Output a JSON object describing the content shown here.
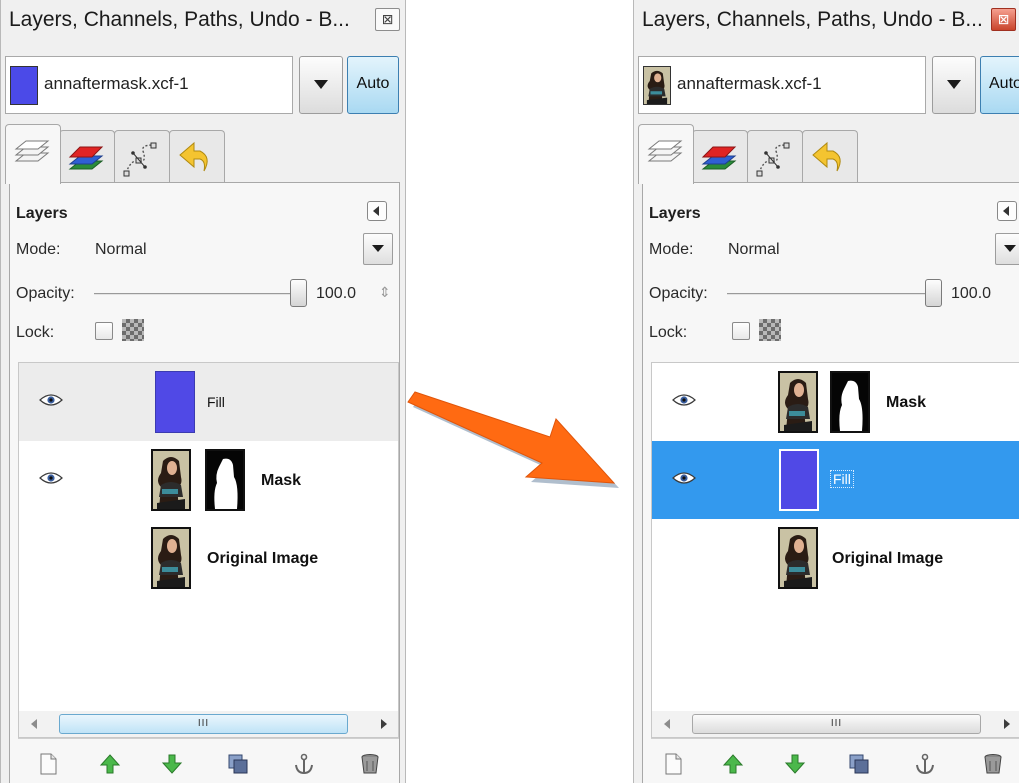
{
  "window": {
    "title": "Layers, Channels, Paths, Undo - B...",
    "close_glyph": "⊠"
  },
  "image_selector": {
    "file_name": "annaftermask.xcf-1",
    "auto_label": "Auto"
  },
  "tabs": [
    "layers-tab",
    "channels-tab",
    "paths-tab",
    "undo-history-tab"
  ],
  "layers_panel": {
    "title": "Layers",
    "mode_label": "Mode:",
    "mode_value": "Normal",
    "opacity_label": "Opacity:",
    "opacity_value": "100.0",
    "lock_label": "Lock:",
    "scroll_grip": "III"
  },
  "before": {
    "layers": [
      {
        "name": "Fill",
        "visible": true,
        "state": "hover"
      },
      {
        "name": "Mask",
        "visible": true,
        "has_mask": true
      },
      {
        "name": "Original Image",
        "visible": false
      }
    ]
  },
  "after": {
    "layers": [
      {
        "name": "Mask",
        "visible": true,
        "has_mask": true
      },
      {
        "name": "Fill",
        "visible": true,
        "state": "selected"
      },
      {
        "name": "Original Image",
        "visible": false
      }
    ]
  },
  "toolbar_icons": [
    "new-layer-icon",
    "raise-layer-icon",
    "lower-layer-icon",
    "duplicate-layer-icon",
    "anchor-layer-icon",
    "delete-layer-icon"
  ],
  "colors": {
    "fill_layer": "#5049e6",
    "selection": "#3399ee",
    "arrow": "#ff6a12"
  }
}
